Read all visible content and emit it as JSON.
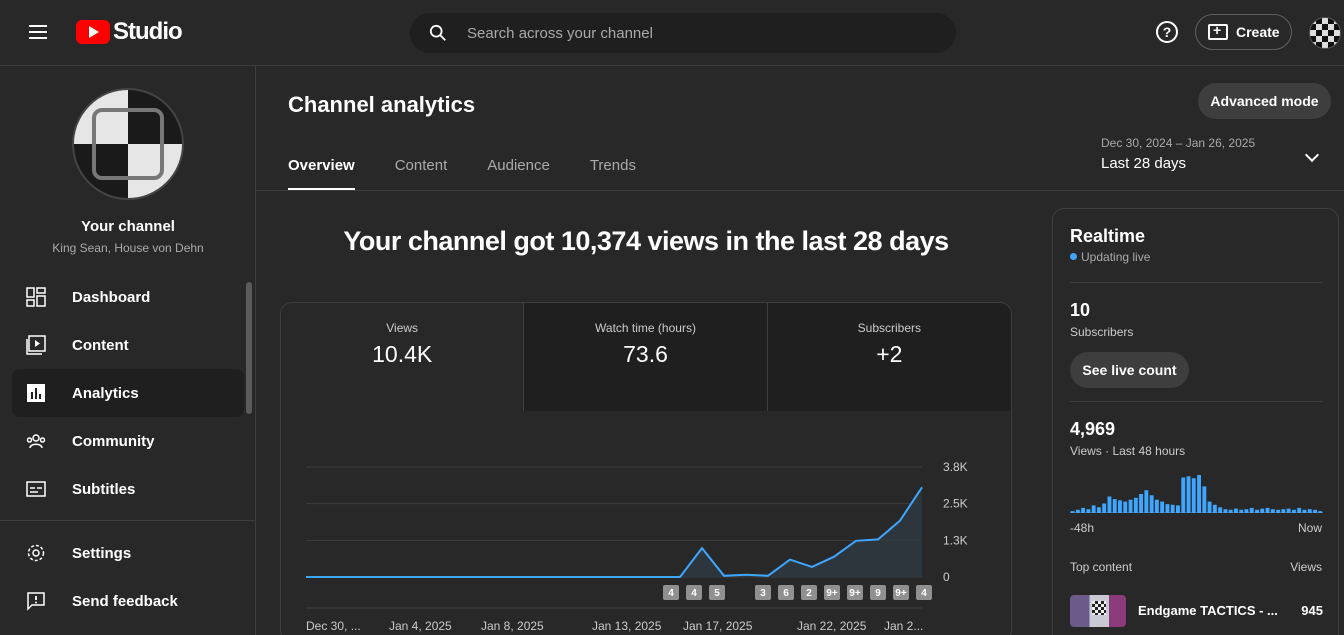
{
  "topbar": {
    "logo_text": "Studio",
    "search_placeholder": "Search across your channel",
    "help_label": "?",
    "create_label": "Create"
  },
  "sidebar": {
    "channel_title": "Your channel",
    "channel_name": "King Sean, House von Dehn",
    "items": [
      {
        "label": "Dashboard",
        "icon": "dashboard-icon"
      },
      {
        "label": "Content",
        "icon": "content-icon"
      },
      {
        "label": "Analytics",
        "icon": "analytics-icon",
        "active": true
      },
      {
        "label": "Community",
        "icon": "community-icon"
      },
      {
        "label": "Subtitles",
        "icon": "subtitles-icon"
      }
    ],
    "bottom_items": [
      {
        "label": "Settings",
        "icon": "gear-icon"
      },
      {
        "label": "Send feedback",
        "icon": "feedback-icon"
      }
    ]
  },
  "main": {
    "title": "Channel analytics",
    "advanced_mode": "Advanced mode",
    "tabs": [
      "Overview",
      "Content",
      "Audience",
      "Trends"
    ],
    "active_tab": "Overview",
    "date_range": {
      "sub": "Dec 30, 2024 – Jan 26, 2025",
      "main": "Last 28 days"
    },
    "headline": "Your channel got 10,374 views in the last 28 days",
    "metrics": [
      {
        "label": "Views",
        "value": "10.4K"
      },
      {
        "label": "Watch time (hours)",
        "value": "73.6"
      },
      {
        "label": "Subscribers",
        "value": "+2"
      }
    ]
  },
  "chart_data": {
    "type": "area",
    "series": [
      {
        "values": [
          0,
          0,
          0,
          0,
          0,
          0,
          0,
          0,
          0,
          0,
          0,
          0,
          0,
          0,
          0,
          0,
          0,
          0,
          1000,
          40,
          80,
          40,
          600,
          350,
          700,
          1250,
          1300,
          1950,
          3100
        ]
      }
    ],
    "y_ticks": [
      "3.8K",
      "2.5K",
      "1.3K",
      "0"
    ],
    "ylim": [
      0,
      3800
    ],
    "x_ticks": [
      "Dec 30, ...",
      "Jan 4, 2025",
      "Jan 8, 2025",
      "Jan 13, 2025",
      "Jan 17, 2025",
      "Jan 22, 2025",
      "Jan 2..."
    ],
    "badges": [
      "4",
      "4",
      "5",
      "3",
      "6",
      "2",
      "9+",
      "9+",
      "9",
      "9+",
      "4"
    ],
    "color": "#3ea6ff",
    "grid": true
  },
  "realtime": {
    "title": "Realtime",
    "status": "Updating live",
    "subscribers_value": "10",
    "subscribers_label": "Subscribers",
    "live_count_button": "See live count",
    "views_value": "4,969",
    "views_label": "Views · Last 48 hours",
    "bars": [
      3,
      5,
      8,
      6,
      12,
      9,
      15,
      26,
      22,
      20,
      18,
      21,
      24,
      30,
      36,
      28,
      21,
      18,
      14,
      13,
      12,
      56,
      58,
      55,
      60,
      42,
      18,
      13,
      9,
      6,
      5,
      7,
      5,
      6,
      8,
      5,
      7,
      8,
      6,
      5,
      6,
      7,
      5,
      8,
      5,
      6,
      5,
      3
    ],
    "axis_left": "-48h",
    "axis_right": "Now",
    "top_content_label": "Top content",
    "top_views_label": "Views",
    "top_item_title": "Endgame TACTICS - ...",
    "top_item_views": "945"
  }
}
